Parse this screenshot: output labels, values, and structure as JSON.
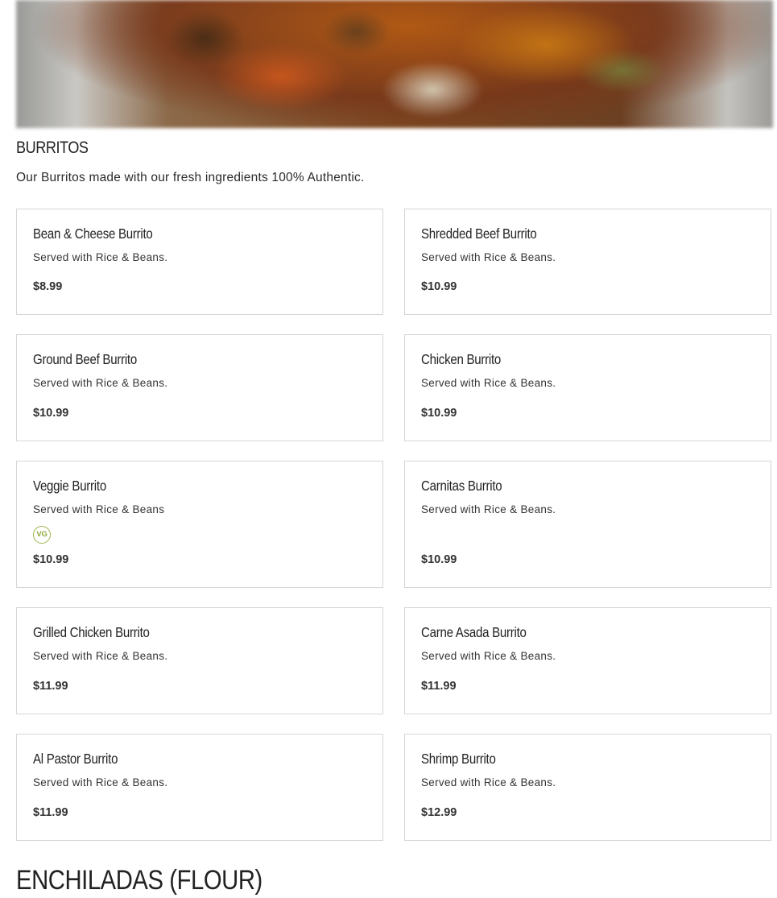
{
  "section": {
    "title": "BURRITOS",
    "description": "Our Burritos made with our fresh ingredients 100% Authentic."
  },
  "items": [
    {
      "name": "Bean & Cheese Burrito",
      "description": "Served with Rice & Beans.",
      "price": "$8.99"
    },
    {
      "name": "Shredded Beef Burrito",
      "description": "Served with Rice & Beans.",
      "price": "$10.99"
    },
    {
      "name": "Ground Beef Burrito",
      "description": "Served with Rice & Beans.",
      "price": "$10.99"
    },
    {
      "name": "Chicken Burrito",
      "description": "Served with Rice & Beans.",
      "price": "$10.99"
    },
    {
      "name": "Veggie Burrito",
      "description": "Served with Rice & Beans",
      "price": "$10.99",
      "badge": "VG",
      "badge_color": "#9bb54a"
    },
    {
      "name": "Carnitas Burrito",
      "description": "Served with Rice & Beans.",
      "price": "$10.99"
    },
    {
      "name": "Grilled Chicken Burrito",
      "description": "Served with Rice & Beans.",
      "price": "$11.99"
    },
    {
      "name": "Carne Asada Burrito",
      "description": "Served with Rice & Beans.",
      "price": "$11.99"
    },
    {
      "name": "Al Pastor Burrito",
      "description": "Served with Rice & Beans.",
      "price": "$11.99"
    },
    {
      "name": "Shrimp Burrito",
      "description": "Served with Rice & Beans.",
      "price": "$12.99"
    }
  ],
  "next_section": {
    "title": "ENCHILADAS (FLOUR)"
  }
}
